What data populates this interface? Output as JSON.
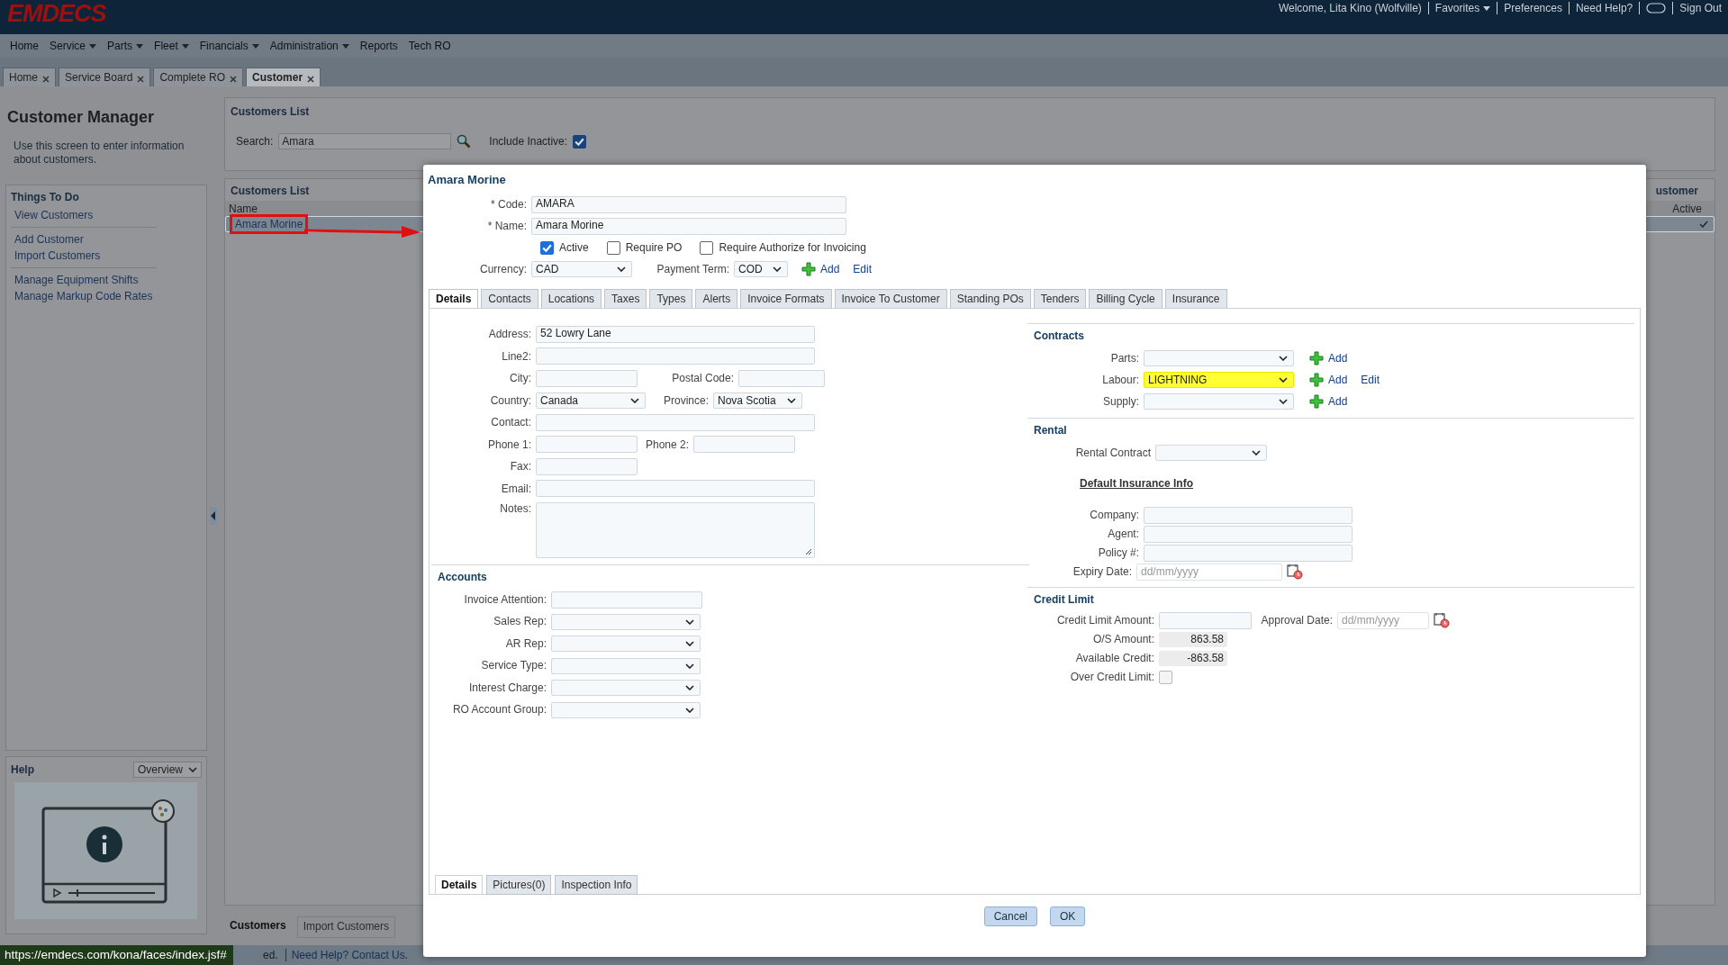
{
  "header": {
    "logo": "EMDECS",
    "welcome": "Welcome, Lita Kino (Wolfville)",
    "links": [
      {
        "label": "Favorites",
        "dropdown": true
      },
      {
        "label": "Preferences",
        "dropdown": false
      },
      {
        "label": "Need Help?",
        "dropdown": false
      }
    ],
    "sign_out": "Sign Out"
  },
  "menu": [
    {
      "label": "Home",
      "dropdown": false
    },
    {
      "label": "Service",
      "dropdown": true
    },
    {
      "label": "Parts",
      "dropdown": true
    },
    {
      "label": "Fleet",
      "dropdown": true
    },
    {
      "label": "Financials",
      "dropdown": true
    },
    {
      "label": "Administration",
      "dropdown": true
    },
    {
      "label": "Reports",
      "dropdown": false
    },
    {
      "label": "Tech RO",
      "dropdown": false
    }
  ],
  "page_tabs": [
    {
      "label": "Home",
      "selected": false
    },
    {
      "label": "Service Board",
      "selected": false
    },
    {
      "label": "Complete RO",
      "selected": false
    },
    {
      "label": "Customer",
      "selected": true
    }
  ],
  "sidebar": {
    "title": "Customer Manager",
    "description": "Use this screen to enter information about customers.",
    "things_to_do": {
      "title": "Things To Do",
      "groups": [
        [
          "View Customers"
        ],
        [
          "Add Customer",
          "Import Customers"
        ],
        [
          "Manage Equipment Shifts",
          "Manage Markup Code Rates"
        ]
      ]
    },
    "help": {
      "title": "Help",
      "dropdown": "Overview"
    }
  },
  "customers_list": {
    "title": "Customers List",
    "search": {
      "label": "Search:",
      "value": "Amara"
    },
    "include_inactive": {
      "label": "Include Inactive:",
      "checked": true
    },
    "list_title": "Customers List",
    "column_2_header": "ustomer",
    "columns": [
      "Name",
      "Active"
    ],
    "rows": [
      {
        "name": "Amara Morine",
        "selected": true,
        "active": true
      }
    ]
  },
  "bottom_tabs": [
    {
      "label": "Customers",
      "selected": true
    },
    {
      "label": "Import Customers",
      "selected": false
    }
  ],
  "footer": {
    "text": "ed.",
    "links": [
      "Need Help? Contact Us."
    ],
    "status_url": "https://emdecs.com/kona/faces/index.jsf#"
  },
  "dialog": {
    "title": "Amara Morine",
    "code": {
      "label": "* Code:",
      "value": "AMARA"
    },
    "name": {
      "label": "* Name:",
      "value": "Amara Morine"
    },
    "flags": [
      {
        "label": "Active",
        "checked": true
      },
      {
        "label": "Require PO",
        "checked": false
      },
      {
        "label": "Require Authorize for Invoicing",
        "checked": false
      }
    ],
    "currency": {
      "label": "Currency:",
      "value": "CAD"
    },
    "payment_term": {
      "label": "Payment Term:",
      "value": "COD",
      "add": "Add",
      "edit": "Edit"
    },
    "tabs": [
      {
        "label": "Details",
        "selected": true
      },
      {
        "label": "Contacts",
        "selected": false
      },
      {
        "label": "Locations",
        "selected": false
      },
      {
        "label": "Taxes",
        "selected": false
      },
      {
        "label": "Types",
        "selected": false
      },
      {
        "label": "Alerts",
        "selected": false
      },
      {
        "label": "Invoice Formats",
        "selected": false
      },
      {
        "label": "Invoice To Customer",
        "selected": false
      },
      {
        "label": "Standing POs",
        "selected": false
      },
      {
        "label": "Tenders",
        "selected": false
      },
      {
        "label": "Billing Cycle",
        "selected": false
      },
      {
        "label": "Insurance",
        "selected": false
      }
    ],
    "address": {
      "address": {
        "label": "Address:",
        "value": "52 Lowry Lane"
      },
      "line2": {
        "label": "Line2:"
      },
      "city": {
        "label": "City:"
      },
      "postal_code": {
        "label": "Postal Code:"
      },
      "country": {
        "label": "Country:",
        "value": "Canada"
      },
      "province": {
        "label": "Province:",
        "value": "Nova Scotia"
      },
      "contact": {
        "label": "Contact:"
      },
      "phone_1": {
        "label": "Phone 1:"
      },
      "phone_2": {
        "label": "Phone 2:"
      },
      "fax": {
        "label": "Fax:"
      },
      "email": {
        "label": "Email:"
      },
      "notes": {
        "label": "Notes:"
      }
    },
    "accounts": {
      "title": "Accounts",
      "fields": [
        {
          "label": "Invoice Attention:",
          "kind": "text"
        },
        {
          "label": "Sales Rep:",
          "kind": "select"
        },
        {
          "label": "AR Rep:",
          "kind": "select"
        },
        {
          "label": "Service Type:",
          "kind": "select"
        },
        {
          "label": "Interest Charge:",
          "kind": "select"
        },
        {
          "label": "RO Account Group:",
          "kind": "select"
        }
      ]
    },
    "contracts": {
      "title": "Contracts",
      "rows": [
        {
          "label": "Parts:",
          "highlighted": false,
          "add": "Add"
        },
        {
          "label": "Labour:",
          "value": "LIGHTNING",
          "highlighted": true,
          "add": "Add",
          "edit": "Edit"
        },
        {
          "label": "Supply:",
          "highlighted": false,
          "add": "Add"
        }
      ]
    },
    "rental": {
      "title": "Rental",
      "contract_label": "Rental Contract"
    },
    "insurance": {
      "title": "Default Insurance Info",
      "fields": [
        {
          "label": "Company:"
        },
        {
          "label": "Agent:"
        },
        {
          "label": "Policy #:"
        }
      ],
      "expiry": {
        "label": "Expiry Date:",
        "placeholder": "dd/mm/yyyy"
      }
    },
    "credit": {
      "title": "Credit Limit",
      "amount_label": "Credit Limit Amount:",
      "approval": {
        "label": "Approval Date:",
        "placeholder": "dd/mm/yyyy"
      },
      "os_amount": {
        "label": "O/S Amount:",
        "value": "863.58"
      },
      "available": {
        "label": "Available Credit:",
        "value": "-863.58"
      },
      "over_limit": {
        "label": "Over Credit Limit:",
        "checked": false
      }
    },
    "bottom_tabs": [
      {
        "label": "Details",
        "selected": true
      },
      {
        "label": "Pictures(0)",
        "selected": false
      },
      {
        "label": "Inspection Info",
        "selected": false
      }
    ],
    "buttons": [
      "Cancel",
      "OK"
    ]
  }
}
